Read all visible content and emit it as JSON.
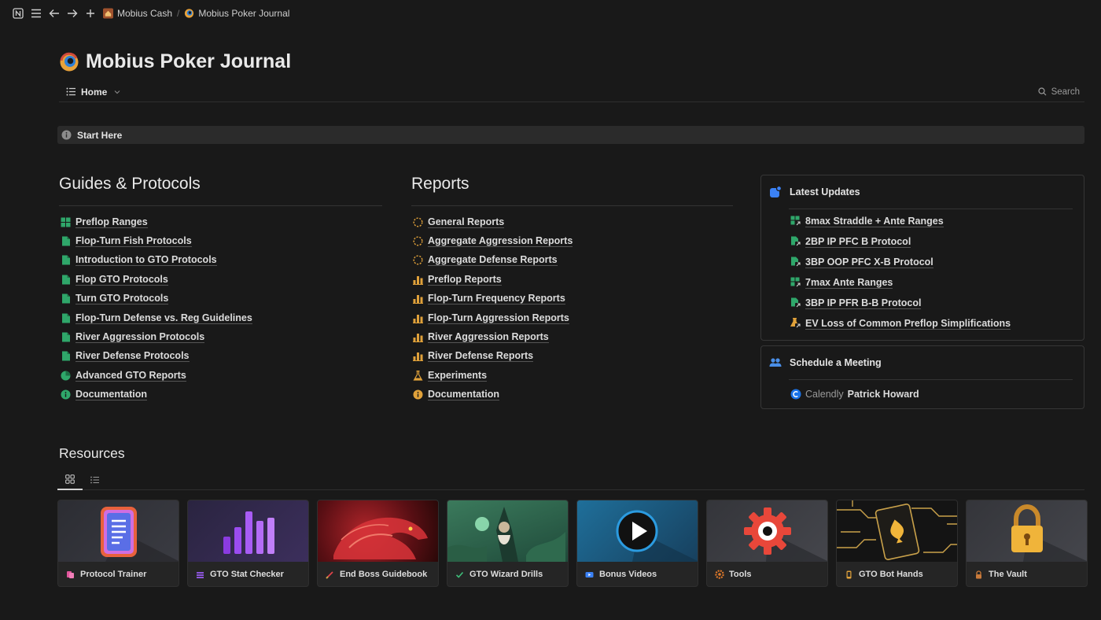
{
  "topbar": {
    "crumbs": [
      "Mobius Cash",
      "Mobius Poker Journal"
    ]
  },
  "page": {
    "title": "Mobius Poker Journal",
    "view": "Home",
    "search": "Search",
    "callout": "Start Here"
  },
  "guides": {
    "heading": "Guides & Protocols",
    "items": [
      {
        "label": "Preflop Ranges",
        "icon": "grid-icon"
      },
      {
        "label": "Flop-Turn Fish Protocols",
        "icon": "document-icon"
      },
      {
        "label": "Introduction to GTO Protocols",
        "icon": "document-icon"
      },
      {
        "label": "Flop GTO Protocols",
        "icon": "document-icon"
      },
      {
        "label": "Turn GTO Protocols",
        "icon": "document-icon"
      },
      {
        "label": "Flop-Turn Defense vs. Reg Guidelines",
        "icon": "document-icon"
      },
      {
        "label": "River Aggression Protocols",
        "icon": "document-icon"
      },
      {
        "label": "River Defense Protocols",
        "icon": "document-icon"
      },
      {
        "label": "Advanced GTO Reports",
        "icon": "pie-icon"
      },
      {
        "label": "Documentation",
        "icon": "info-icon"
      }
    ]
  },
  "reports": {
    "heading": "Reports",
    "items": [
      {
        "label": "General Reports",
        "icon": "dashed-circle-icon"
      },
      {
        "label": "Aggregate Aggression Reports",
        "icon": "dashed-circle-icon"
      },
      {
        "label": "Aggregate Defense Reports",
        "icon": "dashed-circle-icon"
      },
      {
        "label": "Preflop Reports",
        "icon": "bar-chart-icon"
      },
      {
        "label": "Flop-Turn Frequency Reports",
        "icon": "bar-chart-icon"
      },
      {
        "label": "Flop-Turn Aggression Reports",
        "icon": "bar-chart-icon"
      },
      {
        "label": "River Aggression Reports",
        "icon": "bar-chart-icon"
      },
      {
        "label": "River Defense Reports",
        "icon": "bar-chart-icon"
      },
      {
        "label": "Experiments",
        "icon": "flask-icon"
      },
      {
        "label": "Documentation",
        "icon": "info-icon"
      }
    ]
  },
  "latest": {
    "heading": "Latest Updates",
    "items": [
      {
        "label": "8max Straddle + Ante Ranges",
        "icon": "grid-link-icon"
      },
      {
        "label": "2BP IP PFC B Protocol",
        "icon": "doc-link-icon"
      },
      {
        "label": "3BP OOP PFC X-B Protocol",
        "icon": "doc-link-icon"
      },
      {
        "label": "7max Ante Ranges",
        "icon": "grid-link-icon"
      },
      {
        "label": "3BP IP PFR B-B Protocol",
        "icon": "doc-link-icon"
      },
      {
        "label": "EV Loss of Common Preflop Simplifications",
        "icon": "flask-link-icon"
      }
    ]
  },
  "meeting": {
    "heading": "Schedule a Meeting",
    "provider": "Calendly",
    "name": "Patrick Howard"
  },
  "resources": {
    "heading": "Resources",
    "cards": [
      {
        "label": "Protocol Trainer"
      },
      {
        "label": "GTO Stat Checker"
      },
      {
        "label": "End Boss Guidebook"
      },
      {
        "label": "GTO Wizard Drills"
      },
      {
        "label": "Bonus Videos"
      },
      {
        "label": "Tools"
      },
      {
        "label": "GTO Bot Hands"
      },
      {
        "label": "The Vault"
      }
    ]
  },
  "colors": {
    "bg": "#191919",
    "green": "#2fa76a",
    "orange": "#e0a13a",
    "blue": "#3b82f6"
  }
}
